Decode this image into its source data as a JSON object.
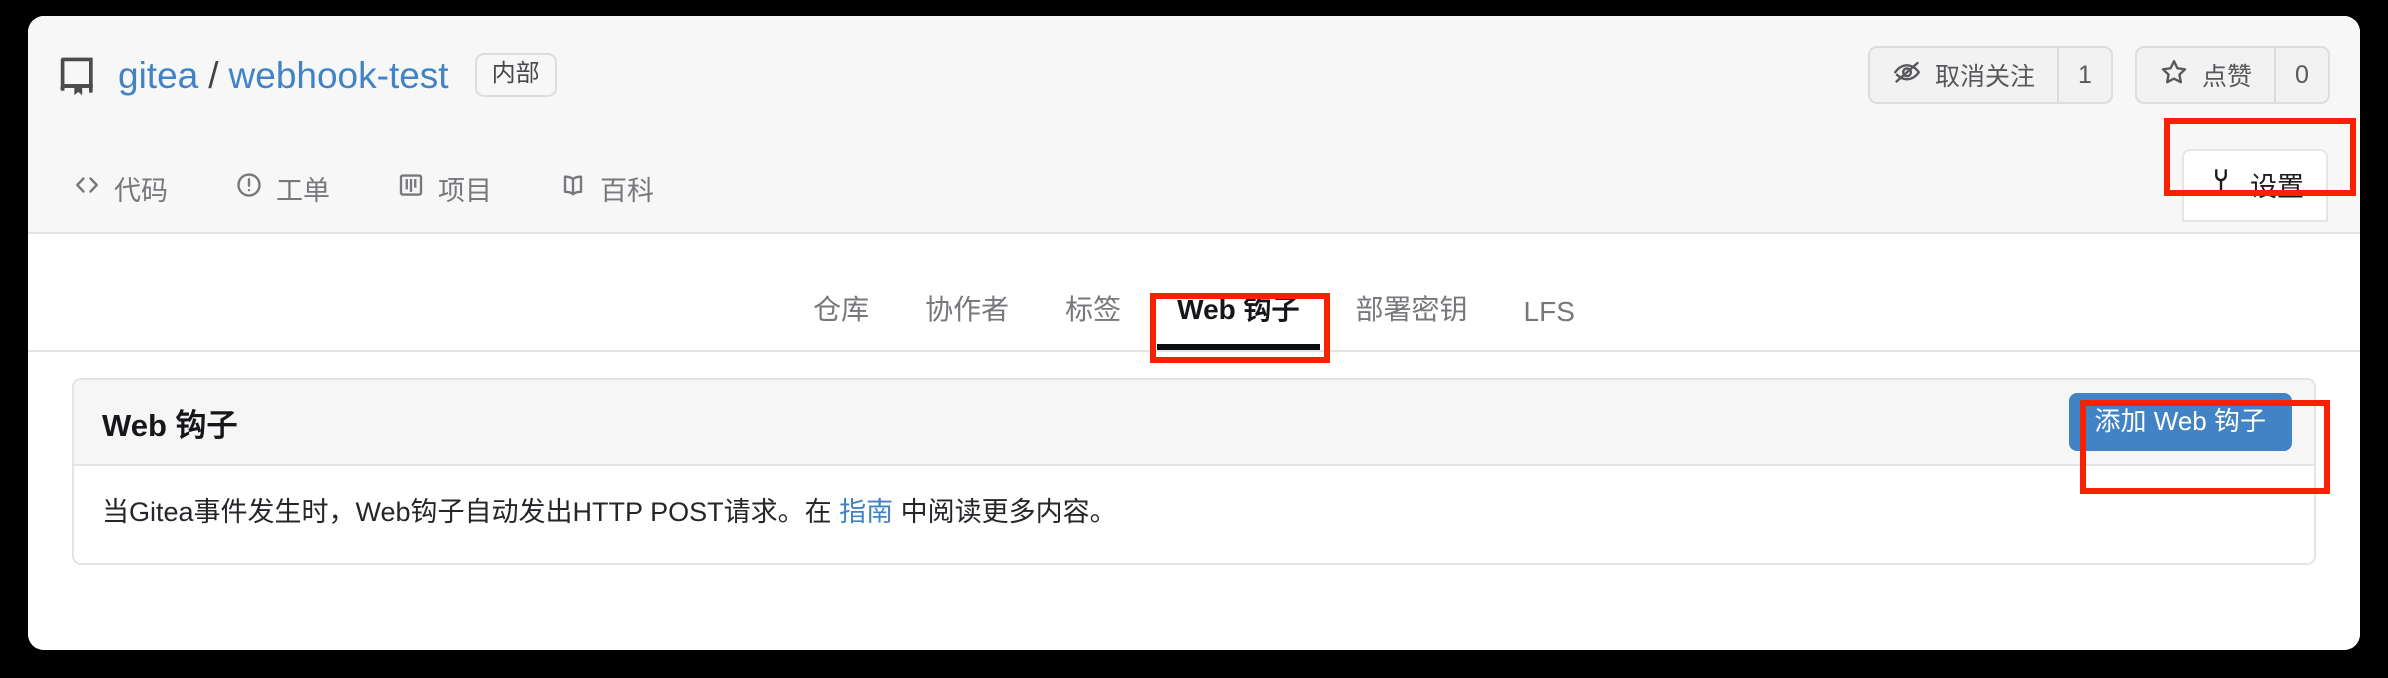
{
  "repo": {
    "owner": "gitea",
    "separator": "/",
    "name": "webhook-test",
    "visibility_badge": "内部",
    "icon": "repo-book-icon"
  },
  "header_actions": {
    "watch": {
      "icon": "eye-slash-icon",
      "label": "取消关注",
      "count": "1"
    },
    "star": {
      "icon": "star-icon",
      "label": "点赞",
      "count": "0"
    }
  },
  "repo_nav": {
    "items": [
      {
        "icon": "code-brackets-icon",
        "label": "代码"
      },
      {
        "icon": "issue-opened-icon",
        "label": "工单"
      },
      {
        "icon": "project-board-icon",
        "label": "项目"
      },
      {
        "icon": "book-open-icon",
        "label": "百科"
      }
    ],
    "settings": {
      "icon": "wrench-icon",
      "label": "设置"
    }
  },
  "settings_nav": {
    "items": [
      {
        "label": "仓库",
        "active": false
      },
      {
        "label": "协作者",
        "active": false
      },
      {
        "label": "标签",
        "active": false
      },
      {
        "label": "Web 钩子",
        "active": true
      },
      {
        "label": "部署密钥",
        "active": false
      },
      {
        "label": "LFS",
        "active": false
      }
    ]
  },
  "webhooks_panel": {
    "title": "Web 钩子",
    "add_button_label": "添加 Web 钩子",
    "description_before": "当Gitea事件发生时，Web钩子自动发出HTTP POST请求。在 ",
    "description_link": "指南",
    "description_after": " 中阅读更多内容。"
  },
  "annotations": {
    "color": "#fa2000",
    "boxes": [
      {
        "name": "settings-button-highlight"
      },
      {
        "name": "webhooks-tab-highlight"
      },
      {
        "name": "add-webhook-button-highlight"
      }
    ]
  },
  "colors": {
    "link": "#4183c4",
    "primary_button": "#4183c4",
    "header_bg": "#f7f7f8",
    "page_bg": "#ffffff",
    "annotation": "#fa2000",
    "active_tab_underline": "#0c0d0e"
  }
}
